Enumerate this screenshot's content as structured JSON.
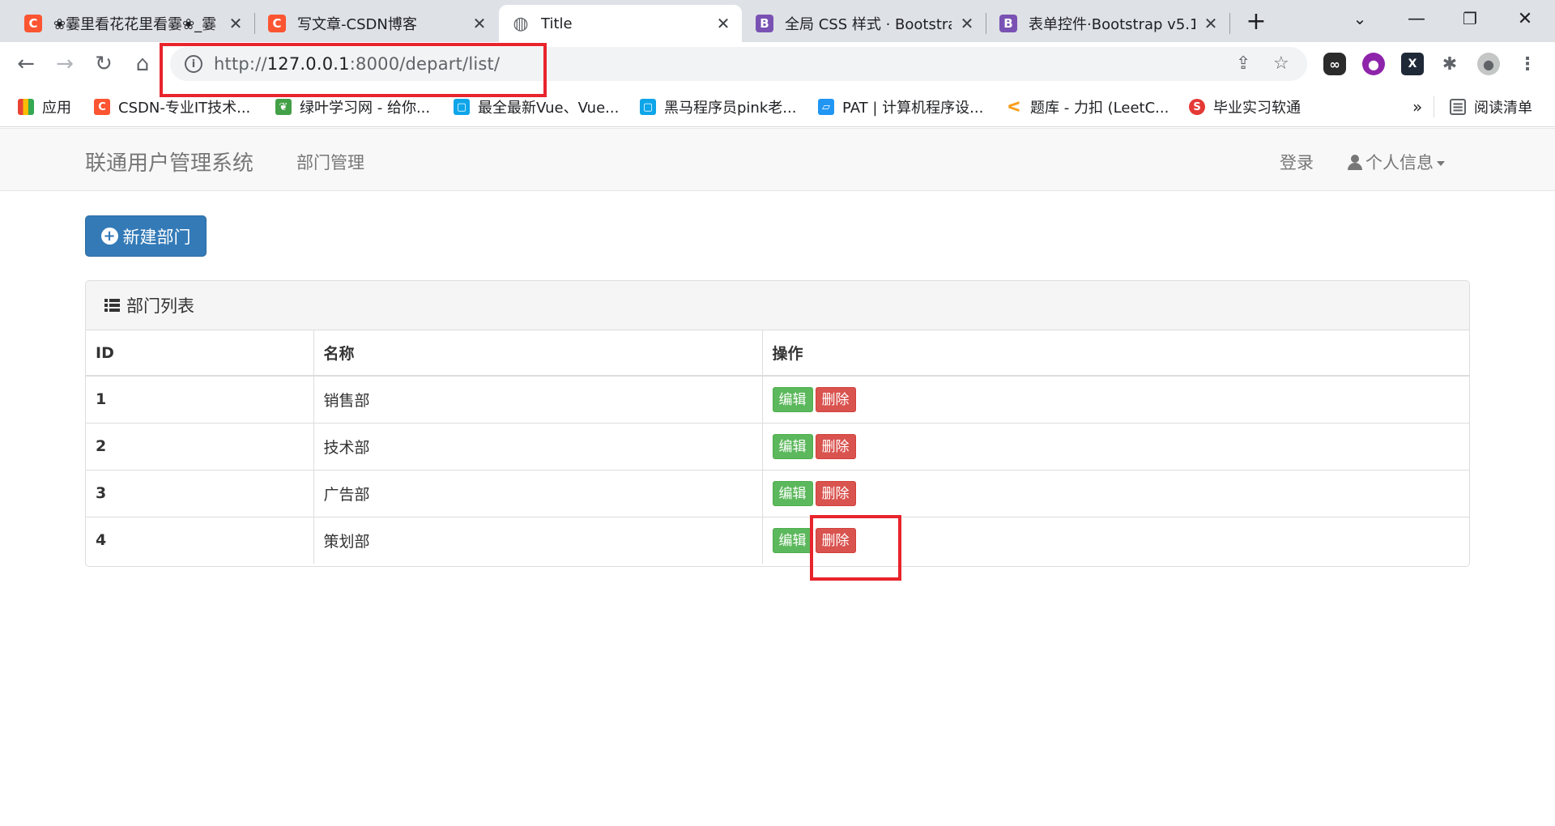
{
  "browser": {
    "tabs": [
      {
        "title": "❀霎里看花花里看霎❀_霎",
        "icon": "C"
      },
      {
        "title": "写文章-CSDN博客",
        "icon": "C"
      },
      {
        "title": "Title",
        "icon": "globe-icon"
      },
      {
        "title": "全局 CSS 样式 · Bootstra",
        "icon": "B"
      },
      {
        "title": "表单控件·Bootstrap v5.1",
        "icon": "B"
      }
    ],
    "close_glyph": "✕",
    "url_prefix": "http://",
    "url_host": "127.0.0.1",
    "url_rest": ":8000/depart/list/",
    "bookmarks": [
      {
        "label": "应用"
      },
      {
        "label": "CSDN-专业IT技术..."
      },
      {
        "label": "绿叶学习网 - 给你..."
      },
      {
        "label": "最全最新Vue、Vue..."
      },
      {
        "label": "黑马程序员pink老..."
      },
      {
        "label": "PAT | 计算机程序设..."
      },
      {
        "label": "题库 - 力扣 (LeetC..."
      },
      {
        "label": "毕业实习软通"
      }
    ],
    "more_bookmarks": "»",
    "reading_list": "阅读清单"
  },
  "navbar": {
    "brand": "联通用户管理系统",
    "dept_link": "部门管理",
    "login": "登录",
    "profile": "个人信息"
  },
  "new_button": {
    "label": "新建部门"
  },
  "panel": {
    "title": "部门列表",
    "headers": {
      "id": "ID",
      "name": "名称",
      "action": "操作"
    },
    "rows": [
      {
        "id": "1",
        "name": "销售部"
      },
      {
        "id": "2",
        "name": "技术部"
      },
      {
        "id": "3",
        "name": "广告部"
      },
      {
        "id": "4",
        "name": "策划部"
      }
    ],
    "edit_label": "编辑",
    "delete_label": "删除"
  },
  "colors": {
    "primary": "#337ab7",
    "success": "#5cb85c",
    "danger": "#d9534f",
    "highlight": "#e8242c"
  }
}
